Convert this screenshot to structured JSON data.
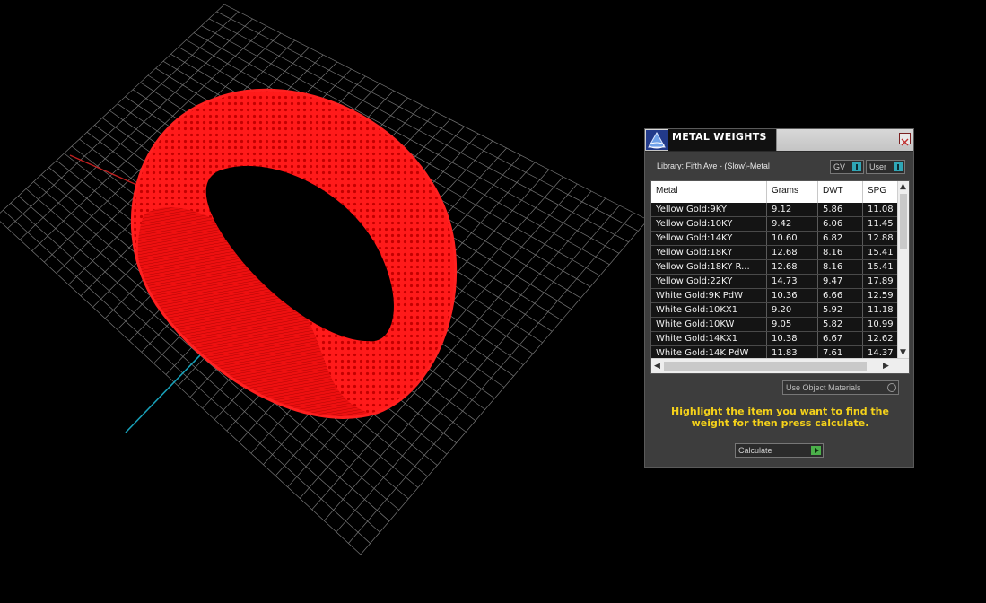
{
  "panel": {
    "title": "METAL WEIGHTS",
    "close_icon": "close-icon",
    "library_label": "Library: Fifth Ave - (Slow)-Metal",
    "toggle_gv": "GV",
    "toggle_user": "User",
    "use_object_materials": "Use Object Materials",
    "hint": "Highlight the item you want to find the weight for then press calculate.",
    "calculate": "Calculate",
    "colors": {
      "hint": "#f5d21a",
      "close": "#c03030",
      "toggle": "#2fa6b6",
      "play": "#4bb04a"
    }
  },
  "table": {
    "headers": [
      "Metal",
      "Grams",
      "DWT",
      "SPG"
    ],
    "rows": [
      [
        "Yellow Gold:9KY",
        "9.12",
        "5.86",
        "11.08"
      ],
      [
        "Yellow Gold:10KY",
        "9.42",
        "6.06",
        "11.45"
      ],
      [
        "Yellow Gold:14KY",
        "10.60",
        "6.82",
        "12.88"
      ],
      [
        "Yellow Gold:18KY",
        "12.68",
        "8.16",
        "15.41"
      ],
      [
        "Yellow Gold:18KY R...",
        "12.68",
        "8.16",
        "15.41"
      ],
      [
        "Yellow Gold:22KY",
        "14.73",
        "9.47",
        "17.89"
      ],
      [
        "White Gold:9K PdW",
        "10.36",
        "6.66",
        "12.59"
      ],
      [
        "White Gold:10KX1",
        "9.20",
        "5.92",
        "11.18"
      ],
      [
        "White Gold:10KW",
        "9.05",
        "5.82",
        "10.99"
      ],
      [
        "White Gold:14KX1",
        "10.38",
        "6.67",
        "12.62"
      ],
      [
        "White Gold:14K PdW",
        "11.83",
        "7.61",
        "14.37"
      ]
    ]
  },
  "viewport": {
    "ring_color": "#ff0000",
    "grid_color": "#8a8a8a",
    "x_axis_color": "#c02020",
    "y_axis_color": "#18a0b8"
  }
}
